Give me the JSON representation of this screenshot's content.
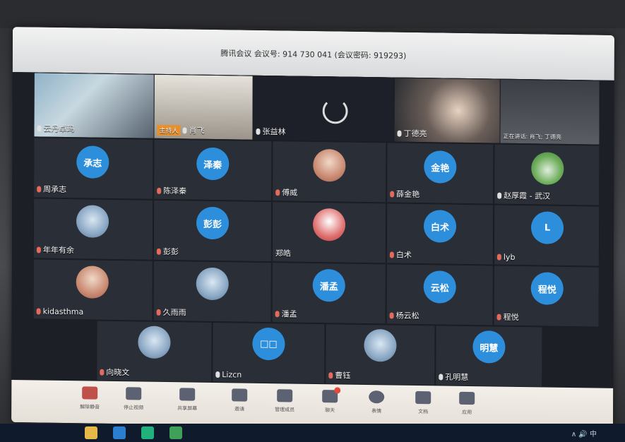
{
  "meeting": {
    "title": "腾讯会议 会议号: 914 730 041 (会议密码: 919293)"
  },
  "participants": [
    {
      "name": "云丹卓玛",
      "type": "video"
    },
    {
      "name": "肖飞",
      "type": "video",
      "host_label": "主持人"
    },
    {
      "name": "张益林",
      "type": "loading"
    },
    {
      "name": "丁德亮",
      "type": "video"
    },
    {
      "name": "正在讲话: 肖飞; 丁德亮",
      "type": "video"
    },
    {
      "name": "周承志",
      "avatar_text": "承志"
    },
    {
      "name": "陈泽秦",
      "avatar_text": "泽秦"
    },
    {
      "name": "傅威",
      "avatar_text": ""
    },
    {
      "name": "薛金艳",
      "avatar_text": "金艳"
    },
    {
      "name": "赵厚霞 - 武汉",
      "avatar_text": ""
    },
    {
      "name": "年年有余",
      "avatar_text": ""
    },
    {
      "name": "彭彭",
      "avatar_text": "彭彭"
    },
    {
      "name": "郑皓",
      "avatar_text": ""
    },
    {
      "name": "白术",
      "avatar_text": "白术"
    },
    {
      "name": "lyb",
      "avatar_text": "L"
    },
    {
      "name": "kidasthma",
      "avatar_text": ""
    },
    {
      "name": "久雨雨",
      "avatar_text": ""
    },
    {
      "name": "潘孟",
      "avatar_text": "潘孟"
    },
    {
      "name": "杨云松",
      "avatar_text": "云松"
    },
    {
      "name": "程悦",
      "avatar_text": "程悦"
    },
    {
      "name": "向晓文",
      "avatar_text": ""
    },
    {
      "name": "Lizcn",
      "avatar_text": "□□"
    },
    {
      "name": "曹钰",
      "avatar_text": ""
    },
    {
      "name": "孔明慧",
      "avatar_text": "明慧"
    }
  ],
  "toolbar": [
    {
      "label": "解除静音",
      "icon": "mic-icon"
    },
    {
      "label": "停止视频",
      "icon": "video-icon"
    },
    {
      "label": "共享屏幕",
      "icon": "share-screen-icon"
    },
    {
      "label": "邀请",
      "icon": "invite-icon"
    },
    {
      "label": "管理成员",
      "icon": "members-icon"
    },
    {
      "label": "聊天",
      "icon": "chat-icon"
    },
    {
      "label": "表情",
      "icon": "emoji-icon"
    },
    {
      "label": "文档",
      "icon": "document-icon"
    },
    {
      "label": "应用",
      "icon": "apps-icon"
    }
  ],
  "taskbar": {
    "tray_text": "∧ 🔊 中"
  },
  "colors": {
    "avatar_blue": "#2d8fdc",
    "host_orange": "#e8902e",
    "muted_red": "#e46a5c"
  }
}
